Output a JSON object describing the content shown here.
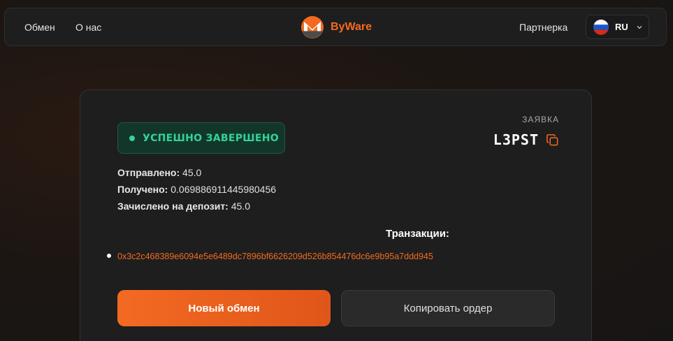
{
  "nav": {
    "links": [
      {
        "label": "Обмен"
      },
      {
        "label": "О нас"
      }
    ],
    "brand": "ByWare",
    "partner": "Партнерка",
    "lang": "RU"
  },
  "order": {
    "status": "УСПЕШНО ЗАВЕРШЕНО",
    "label": "ЗАЯВКА",
    "id": "L3PST",
    "sent_label": "Отправлено:",
    "sent_value": "45.0",
    "received_label": "Получено:",
    "received_value": "0.069886911445980456",
    "deposit_label": "Зачислено на депозит:",
    "deposit_value": "45.0",
    "transactions_title": "Транзакции:",
    "transactions": [
      "0x3c2c468389e6094e5e6489dc7896bf6626209d526b854476dc6e9b95a7ddd945"
    ]
  },
  "actions": {
    "new_exchange": "Новый обмен",
    "copy_order": "Копировать ордер"
  },
  "colors": {
    "accent": "#f26a22",
    "success": "#34d399",
    "card": "#1e1e1e"
  },
  "icons": [
    "monero-logo-icon",
    "russia-flag-icon",
    "chevron-down-icon",
    "copy-icon"
  ]
}
